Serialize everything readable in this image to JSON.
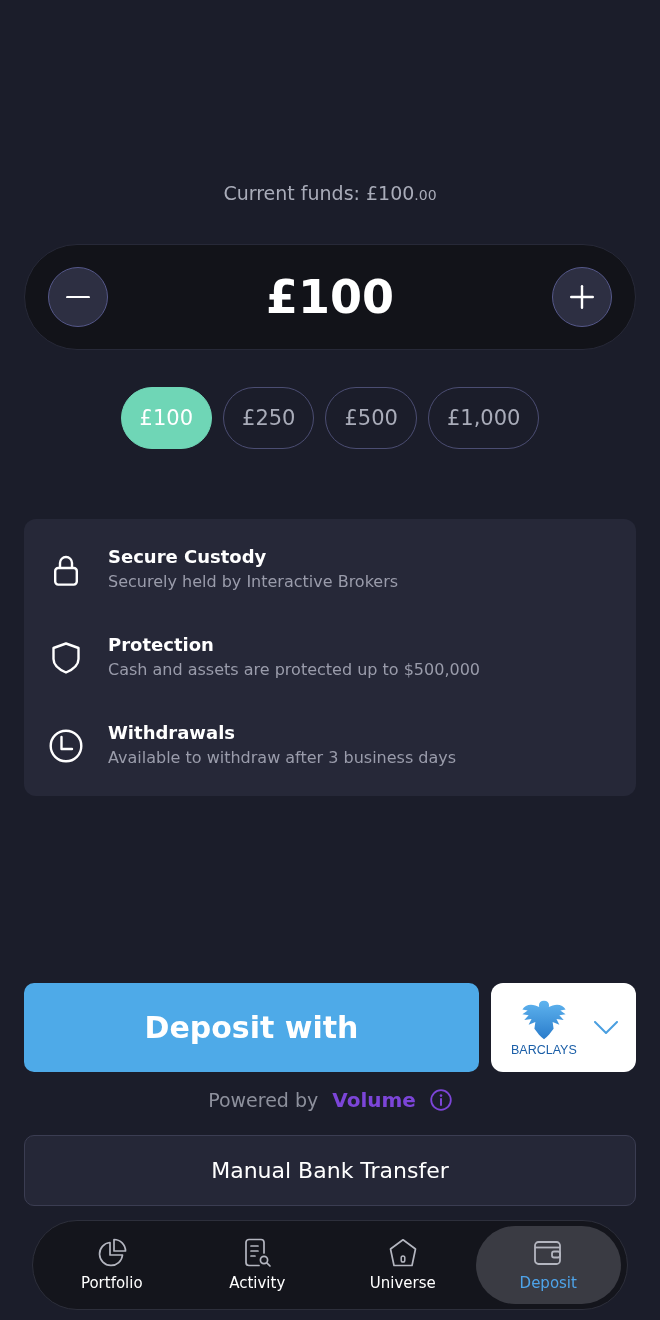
{
  "current_funds": {
    "label": "Current funds:",
    "amount": "£100",
    "decimals": ".00"
  },
  "amount_stepper": {
    "value": "£100"
  },
  "presets": [
    {
      "label": "£100",
      "selected": true
    },
    {
      "label": "£250",
      "selected": false
    },
    {
      "label": "£500",
      "selected": false
    },
    {
      "label": "£1,000",
      "selected": false
    }
  ],
  "features": [
    {
      "title": "Secure Custody",
      "description": "Securely held by Interactive Brokers"
    },
    {
      "title": "Protection",
      "description": "Cash and assets are protected up to $500,000"
    },
    {
      "title": "Withdrawals",
      "description": "Available to withdraw after 3 business days"
    }
  ],
  "deposit": {
    "button": "Deposit with",
    "bank": "BARCLAYS"
  },
  "powered_by": {
    "label": "Powered by",
    "brand": "Volume"
  },
  "manual_transfer": {
    "label": "Manual Bank Transfer"
  },
  "bottom_nav": [
    {
      "label": "Portfolio",
      "selected": false
    },
    {
      "label": "Activity",
      "selected": false
    },
    {
      "label": "Universe",
      "selected": false
    },
    {
      "label": "Deposit",
      "selected": true
    }
  ]
}
